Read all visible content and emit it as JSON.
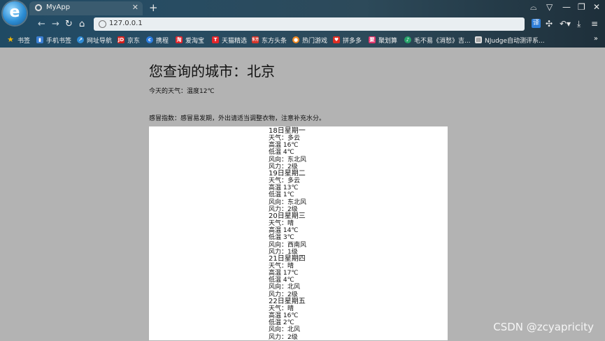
{
  "browser": {
    "tab_title": "MyApp",
    "url": "127.0.0.1",
    "bookmarks": [
      {
        "label": "书签",
        "icon": "star-icon",
        "color": "#f2b705"
      },
      {
        "label": "手机书签",
        "icon": "phone-bookmark-icon",
        "color": "#3b7fd4"
      },
      {
        "label": "网址导航",
        "icon": "nav-icon",
        "color": "#2f8bd5"
      },
      {
        "label": "京东",
        "icon": "jd-icon",
        "color": "#d8201c"
      },
      {
        "label": "携程",
        "icon": "ctrip-icon",
        "color": "#2a7ce0"
      },
      {
        "label": "爱淘宝",
        "icon": "aitaobao-icon",
        "color": "#e3262c"
      },
      {
        "label": "天猫精选",
        "icon": "tmall-icon",
        "color": "#e5262b"
      },
      {
        "label": "东方头条",
        "icon": "dftt-icon",
        "color": "#d6362c"
      },
      {
        "label": "热门游戏",
        "icon": "game-icon",
        "color": "#f08a24"
      },
      {
        "label": "拼多多",
        "icon": "pdd-icon",
        "color": "#e02e24"
      },
      {
        "label": "聚划算",
        "icon": "juhuasuan-icon",
        "color": "#e3346b"
      },
      {
        "label": "毛不易《消愁》吉...",
        "icon": "music-icon",
        "color": "#27a36a"
      },
      {
        "label": "NJudge自动测评系...",
        "icon": "page-icon",
        "color": "#dcdcdc"
      }
    ]
  },
  "page": {
    "heading": "您查询的城市：北京",
    "today": "今天的天气：温度12℃",
    "cold_index": "感冒指数：感冒易发期，外出请适当调整衣物，注意补充水分。",
    "forecast": [
      {
        "day": "18日星期一",
        "weather": "天气：多云",
        "high": "高温 16℃",
        "low": "低温 4℃",
        "wind_dir": "风向：东北风",
        "wind_force": "风力：2级"
      },
      {
        "day": "19日星期二",
        "weather": "天气：多云",
        "high": "高温 13℃",
        "low": "低温 1℃",
        "wind_dir": "风向：东北风",
        "wind_force": "风力：2级"
      },
      {
        "day": "20日星期三",
        "weather": "天气：晴",
        "high": "高温 14℃",
        "low": "低温 3℃",
        "wind_dir": "风向：西南风",
        "wind_force": "风力：1级"
      },
      {
        "day": "21日星期四",
        "weather": "天气：晴",
        "high": "高温 17℃",
        "low": "低温 4℃",
        "wind_dir": "风向：北风",
        "wind_force": "风力：2级"
      },
      {
        "day": "22日星期五",
        "weather": "天气：晴",
        "high": "高温 16℃",
        "low": "低温 2℃",
        "wind_dir": "风向：北风",
        "wind_force": "风力：2级"
      }
    ]
  },
  "watermark": "CSDN @zcyapricity"
}
